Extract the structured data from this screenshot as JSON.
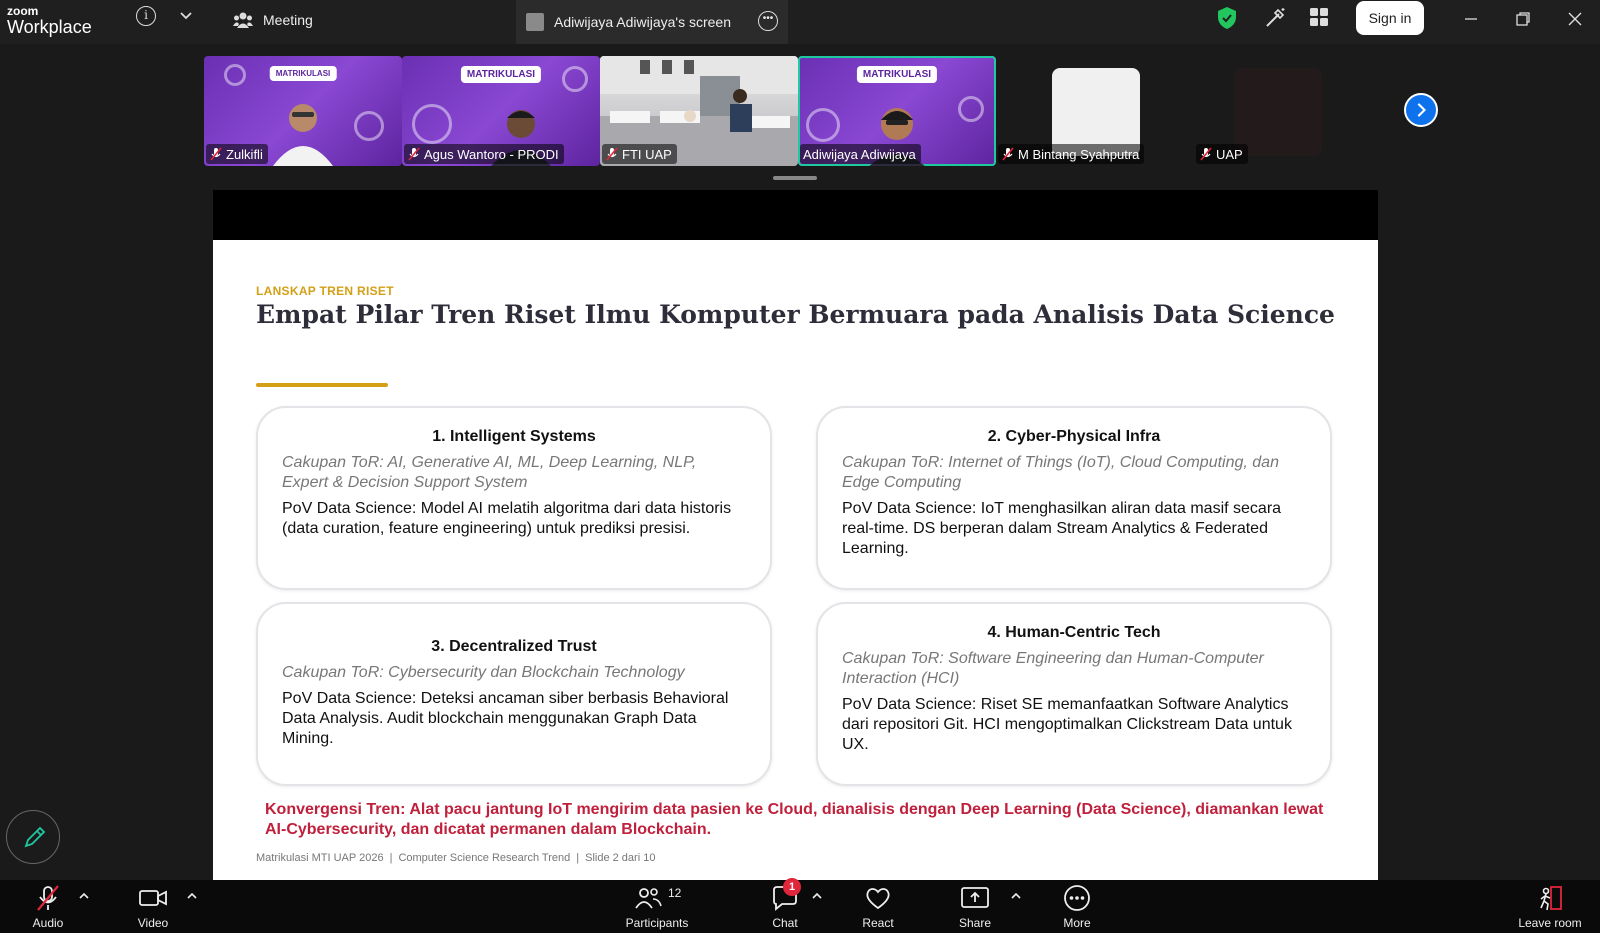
{
  "app": {
    "brand_small": "zoom",
    "brand_big": "Workplace"
  },
  "header": {
    "meeting_tab": "Meeting",
    "share_tab": "Adiwijaya Adiwijaya's screen",
    "signin": "Sign in"
  },
  "participants": [
    {
      "name": "Zulkifli",
      "muted": true
    },
    {
      "name": "Agus Wantoro - PRODI",
      "muted": true
    },
    {
      "name": "FTI UAP",
      "muted": true
    },
    {
      "name": "Adiwijaya Adiwijaya",
      "muted": false,
      "active": true
    },
    {
      "name": "M Bintang Syahputra",
      "muted": true
    },
    {
      "name": "UAP",
      "muted": true
    }
  ],
  "tile_banners": {
    "t1": "MATRIKULASI",
    "t2": "MATRIKULASI",
    "t4": "MATRIKULASI"
  },
  "slide": {
    "kicker": "LANSKAP TREN RISET",
    "title": "Empat Pilar Tren Riset Ilmu Komputer Bermuara pada Analisis Data Science",
    "cards": [
      {
        "title": "1. Intelligent Systems",
        "scope": "Cakupan ToR: AI, Generative AI, ML, Deep Learning, NLP, Expert & Decision Support System",
        "pov": "PoV Data Science: Model AI melatih algoritma dari data historis (data curation, feature engineering) untuk prediksi presisi."
      },
      {
        "title": "2. Cyber-Physical Infra",
        "scope": "Cakupan ToR: Internet of Things (IoT), Cloud Computing, dan Edge Computing",
        "pov": "PoV Data Science: IoT menghasilkan aliran data masif secara real-time. DS berperan dalam Stream Analytics & Federated Learning."
      },
      {
        "title": "3. Decentralized Trust",
        "scope": "Cakupan ToR: Cybersecurity dan Blockchain Technology",
        "pov": "PoV Data Science: Deteksi ancaman siber berbasis Behavioral Data Analysis. Audit blockchain menggunakan Graph Data Mining."
      },
      {
        "title": "4. Human-Centric Tech",
        "scope": "Cakupan ToR: Software Engineering dan Human-Computer Interaction (HCI)",
        "pov": "PoV Data Science: Riset SE memanfaatkan Software Analytics dari repositori Git. HCI mengoptimalkan Clickstream Data untuk UX."
      }
    ],
    "convergence": "Konvergensi Tren: Alat pacu jantung IoT mengirim data pasien ke Cloud, dianalisis dengan Deep Learning (Data Science), diamankan lewat AI-Cybersecurity, dan dicatat permanen dalam Blockchain.",
    "footer": {
      "course": "Matrikulasi MTI UAP 2026",
      "topic": "Computer Science Research Trend",
      "slide": "Slide 2 dari 10",
      "separator": "|"
    }
  },
  "toolbar": {
    "audio": "Audio",
    "video": "Video",
    "participants": "Participants",
    "participants_count": "12",
    "chat": "Chat",
    "chat_badge": "1",
    "react": "React",
    "share": "Share",
    "more": "More",
    "leave": "Leave room"
  },
  "colors": {
    "accent_gold": "#d4a017",
    "convergence_red": "#c0203c",
    "active_speaker": "#1fc9a0",
    "zoom_blue": "#0e72ed",
    "shield_green": "#22c55e"
  },
  "icons": [
    "info-icon",
    "chevron-down-icon",
    "meeting-people-icon",
    "more-dots-icon",
    "shield-check-icon",
    "magic-wand-icon",
    "apps-grid-icon",
    "minimize-icon",
    "restore-icon",
    "close-icon",
    "mic-off-icon",
    "chevron-right-icon",
    "pencil-icon",
    "video-camera-icon",
    "participants-icon",
    "chat-icon",
    "heart-icon",
    "share-screen-icon",
    "more-circle-icon",
    "leave-door-icon"
  ]
}
